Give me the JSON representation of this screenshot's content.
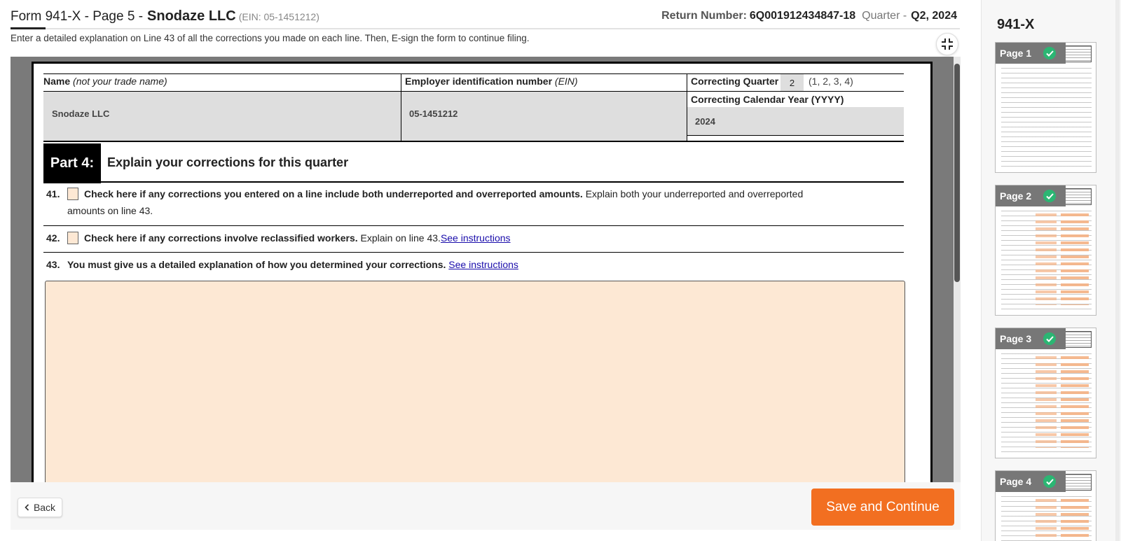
{
  "header": {
    "form_page": "Form 941-X - Page 5 -",
    "company": "Snodaze LLC",
    "ein_paren": "(EIN: 05-1451212)",
    "return_label": "Return Number:",
    "return_number": "6Q001912434847-18",
    "quarter_label": "Quarter -",
    "quarter_value": "Q2, 2024"
  },
  "instruction": "Enter a detailed explanation on Line 43 of all the corrections you made on each line. Then, E-sign the form to continue filing.",
  "form": {
    "name_label": "Name",
    "name_note": "(not your trade name)",
    "ein_label": "Employer identification number",
    "ein_note": "(EIN)",
    "correcting_quarter_label": "Correcting Quarter",
    "correcting_quarter_value": "2",
    "correcting_quarter_options": "(1, 2, 3, 4)",
    "correcting_year_label": "Correcting Calendar Year (YYYY)",
    "correcting_year_value": "2024",
    "name_value": "Snodaze LLC",
    "ein_value": "05-1451212",
    "part_label": "Part 4:",
    "part_title": "Explain your corrections for this quarter",
    "line41_num": "41.",
    "line41_bold": "Check here if any corrections you entered on a line include both underreported and overreported amounts.",
    "line41_text": "Explain both your underreported and overreported",
    "line41_text2": "amounts on line 43.",
    "line42_num": "42.",
    "line42_bold": "Check here if any corrections involve reclassified workers.",
    "line42_text": "Explain on line 43.",
    "line42_link": "See instructions",
    "line43_num": "43.",
    "line43_bold": "You must give us a detailed explanation of how you determined your corrections.",
    "line43_link": "See instructions",
    "explanation_value": ""
  },
  "footer": {
    "back_label": "Back",
    "save_label": "Save and Continue"
  },
  "sidebar": {
    "title": "941-X",
    "pages": [
      {
        "label": "Page 1",
        "completed": true
      },
      {
        "label": "Page 2",
        "completed": true
      },
      {
        "label": "Page 3",
        "completed": true
      },
      {
        "label": "Page 4",
        "completed": true
      }
    ]
  },
  "colors": {
    "accent": "#f26f21",
    "field_fill": "#fde8d4",
    "complete": "#2bb673",
    "link": "#1a0dab"
  },
  "icons": [
    "collapse-icon",
    "chevron-left-icon",
    "check-icon"
  ]
}
